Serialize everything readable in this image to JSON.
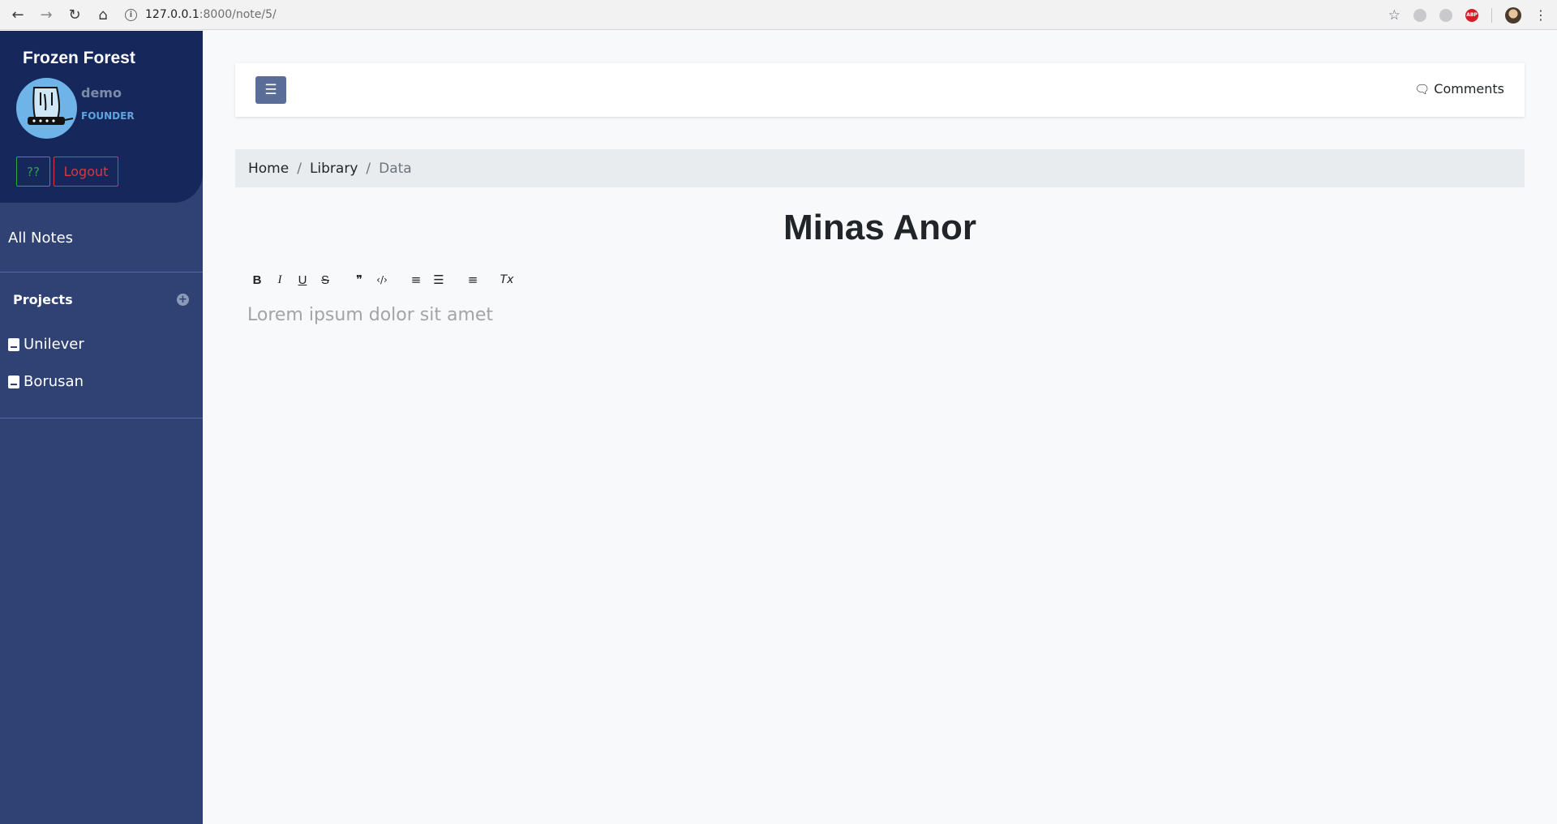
{
  "browser": {
    "url_host": "127.0.0.1",
    "url_path": ":8000/note/5/",
    "icons": [
      "back-icon",
      "forward-icon",
      "reload-icon",
      "home-icon",
      "info-icon",
      "star-icon",
      "menu-kebab-icon"
    ]
  },
  "sidebar": {
    "brand": "Frozen Forest",
    "username": "demo",
    "role": "FOUNDER",
    "help_label": "??",
    "logout_label": "Logout",
    "all_notes_label": "All Notes",
    "projects_label": "Projects",
    "projects": [
      {
        "label": "Unilever"
      },
      {
        "label": "Borusan"
      }
    ]
  },
  "topbar": {
    "comments_label": "Comments"
  },
  "breadcrumb": {
    "items": [
      "Home",
      "Library",
      "Data"
    ]
  },
  "note": {
    "title": "Minas Anor",
    "placeholder": "Lorem ipsum dolor sit amet"
  },
  "toolbar": {
    "bold": "B",
    "italic": "I",
    "underline": "U",
    "strike": "S",
    "quote": "❞",
    "code": "‹/›",
    "ordered_list": "≡",
    "bullet_list": "☰",
    "align": "≡",
    "clear": "Tx"
  },
  "colors": {
    "sidebar_bg": "#2f4273",
    "sidebar_head_bg": "#16285b",
    "help_button": "#28a745",
    "logout_button": "#dc3545",
    "menu_button": "#5a6d99"
  }
}
